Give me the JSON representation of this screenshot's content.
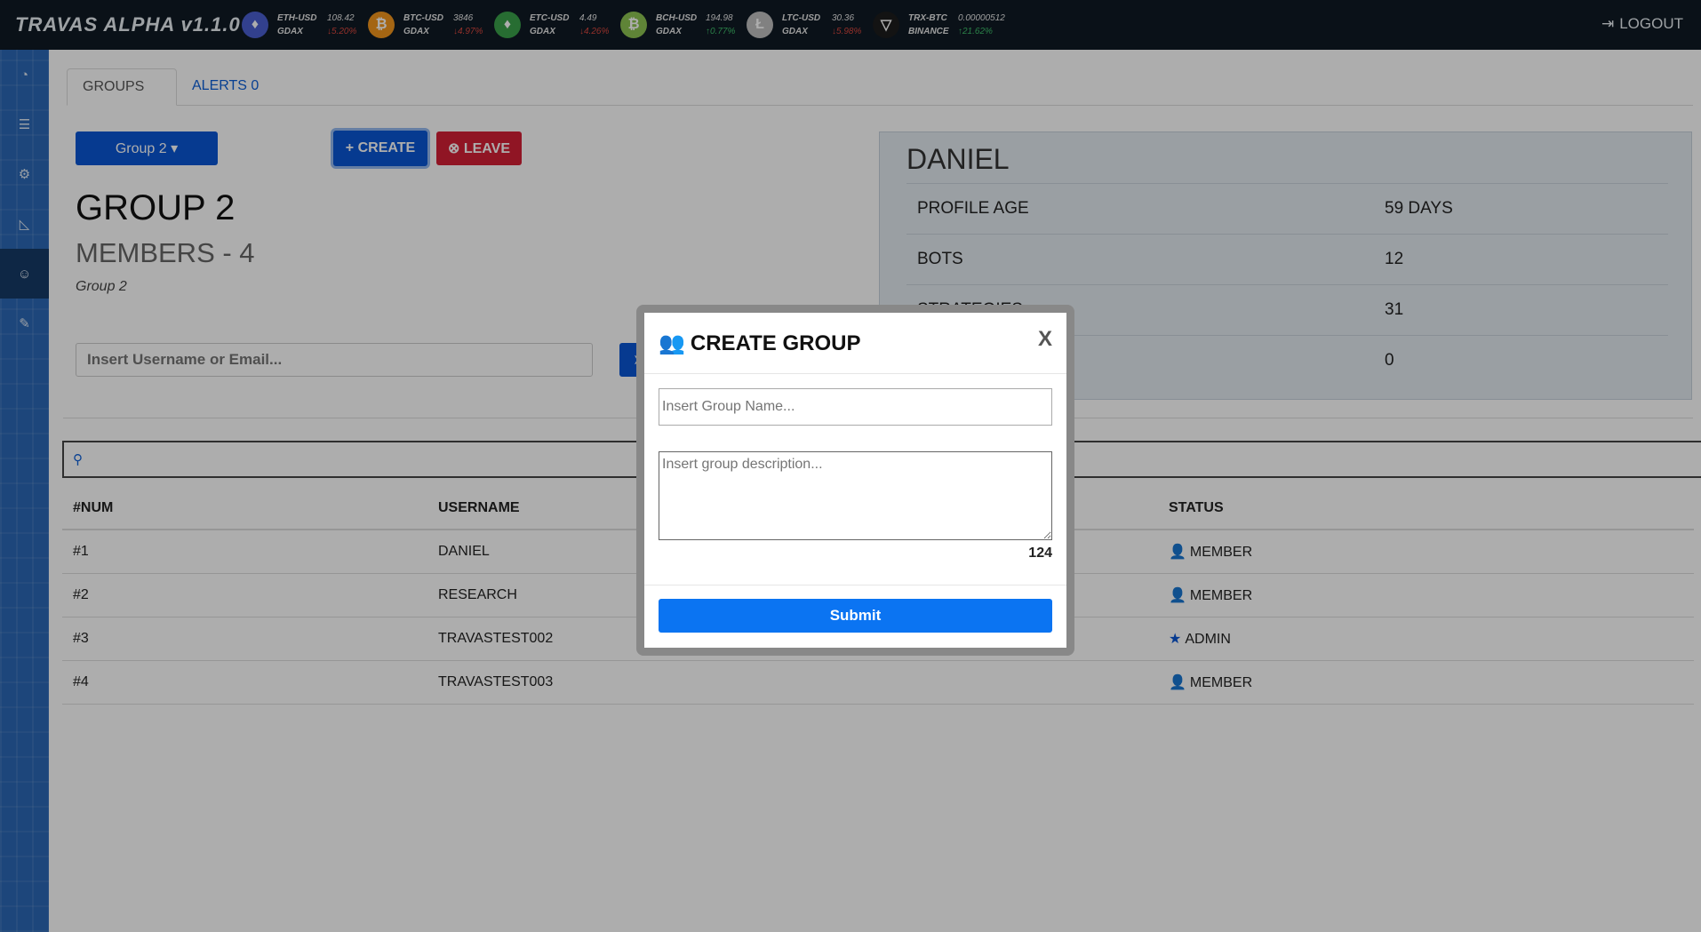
{
  "app": {
    "title": "TRAVAS ALPHA v1.1.0",
    "logout_label": "LOGOUT"
  },
  "tickers": [
    {
      "symbol": "ETH-USD",
      "exchange": "GDAX",
      "price": "108.42",
      "change": "↓5.20%",
      "direction": "down",
      "icon": "ethereum-icon",
      "color": "#4a5fd0",
      "glyph": "♦"
    },
    {
      "symbol": "BTC-USD",
      "exchange": "GDAX",
      "price": "3846",
      "change": "↓4.97%",
      "direction": "down",
      "icon": "bitcoin-icon",
      "color": "#f2961d",
      "glyph": "₿"
    },
    {
      "symbol": "ETC-USD",
      "exchange": "GDAX",
      "price": "4.49",
      "change": "↓4.26%",
      "direction": "down",
      "icon": "ethereum-classic-icon",
      "color": "#3aa14a",
      "glyph": "♦"
    },
    {
      "symbol": "BCH-USD",
      "exchange": "GDAX",
      "price": "194.98",
      "change": "↑0.77%",
      "direction": "up",
      "icon": "bitcoin-cash-icon",
      "color": "#8dc351",
      "glyph": "₿"
    },
    {
      "symbol": "LTC-USD",
      "exchange": "GDAX",
      "price": "30.36",
      "change": "↓5.98%",
      "direction": "down",
      "icon": "litecoin-icon",
      "color": "#bfbfbf",
      "glyph": "Ł"
    },
    {
      "symbol": "TRX-BTC",
      "exchange": "BINANCE",
      "price": "0.00000512",
      "change": "↑21.62%",
      "direction": "up",
      "icon": "tron-icon",
      "color": "#1c1c1c",
      "glyph": "▽"
    }
  ],
  "sidebar": {
    "items": [
      {
        "icon": "dashboard-icon",
        "glyph": "◔"
      },
      {
        "icon": "sliders-icon",
        "glyph": "☰"
      },
      {
        "icon": "gears-icon",
        "glyph": "⚙"
      },
      {
        "icon": "area-chart-icon",
        "glyph": "◺"
      },
      {
        "icon": "users-icon",
        "glyph": "☺",
        "active": true
      },
      {
        "icon": "wrench-icon",
        "glyph": "✎"
      }
    ]
  },
  "tabs": [
    {
      "label": "GROUPS",
      "active": true
    },
    {
      "label": "ALERTS 0",
      "active": false
    }
  ],
  "group": {
    "selector_label": "Group 2 ▾",
    "create_label": "+ CREATE",
    "leave_label": "⊗ LEAVE",
    "title": "GROUP 2",
    "members_label": "MEMBERS - 4",
    "description": "Group 2",
    "invite_placeholder": "Insert Username or Email..."
  },
  "profile": {
    "name": "DANIEL",
    "rows": [
      {
        "label": "PROFILE AGE",
        "value": "59 DAYS"
      },
      {
        "label": "BOTS",
        "value": "12"
      },
      {
        "label": "STRATEGIES",
        "value": "31"
      },
      {
        "label": "",
        "value": "0"
      }
    ]
  },
  "members_table": {
    "headers": [
      "#NUM",
      "USERNAME",
      "",
      "STATUS"
    ],
    "rows": [
      {
        "num": "#1",
        "username": "DANIEL",
        "status": "MEMBER",
        "status_icon": "user-icon",
        "glyph": "👤"
      },
      {
        "num": "#2",
        "username": "RESEARCH",
        "status": "MEMBER",
        "status_icon": "user-icon",
        "glyph": "👤"
      },
      {
        "num": "#3",
        "username": "TRAVASTEST002",
        "status": "ADMIN",
        "status_icon": "star-icon",
        "glyph": "★"
      },
      {
        "num": "#4",
        "username": "TRAVASTEST003",
        "status": "MEMBER",
        "status_icon": "user-icon",
        "glyph": "👤"
      }
    ]
  },
  "modal": {
    "title": "CREATE GROUP",
    "close_label": "X",
    "name_placeholder": "Insert Group Name...",
    "description_placeholder": "Insert group description...",
    "char_count": "124",
    "submit_label": "Submit"
  },
  "colors": {
    "primary": "#0a56d4",
    "danger": "#d51f36",
    "submit": "#0b74f2",
    "topbar": "#0f1a24",
    "sidebar": "#2c68b6"
  }
}
